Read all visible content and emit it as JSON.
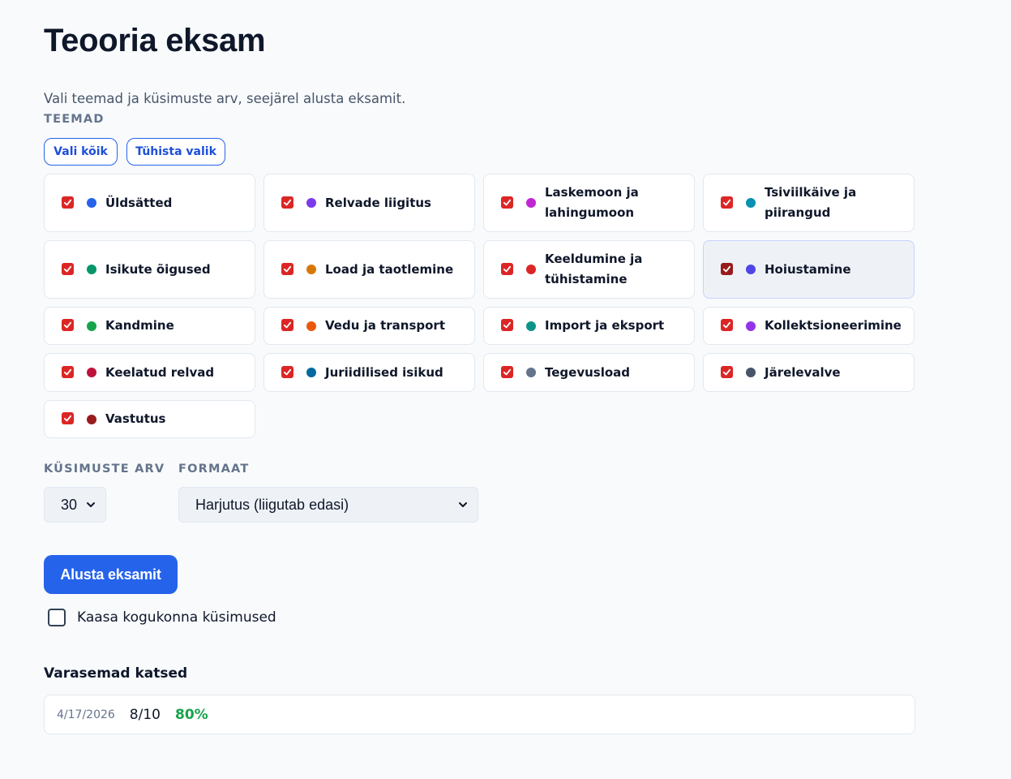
{
  "page": {
    "title": "Teooria eksam",
    "subtitle": "Vali teemad ja küsimuste arv, seejärel alusta eksamit."
  },
  "topics_section": {
    "label": "TEEMAD",
    "select_all": "Vali kõik",
    "clear_selection": "Tühista valik",
    "items": [
      {
        "label": "Üldsätted",
        "color": "#2563eb",
        "checked": true
      },
      {
        "label": "Relvade liigitus",
        "color": "#7c3aed",
        "checked": true
      },
      {
        "label": "Laskemoon ja lahingumoon",
        "color": "#c026d3",
        "checked": true
      },
      {
        "label": "Tsiviilkäive ja piirangud",
        "color": "#0891b2",
        "checked": true
      },
      {
        "label": "Isikute õigused",
        "color": "#059669",
        "checked": true
      },
      {
        "label": "Load ja taotlemine",
        "color": "#d97706",
        "checked": true
      },
      {
        "label": "Keeldumine ja tühistamine",
        "color": "#dc2626",
        "checked": true
      },
      {
        "label": "Hoiustamine",
        "color": "#4f46e5",
        "checked": true
      },
      {
        "label": "Kandmine",
        "color": "#16a34a",
        "checked": true
      },
      {
        "label": "Vedu ja transport",
        "color": "#ea580c",
        "checked": true
      },
      {
        "label": "Import ja eksport",
        "color": "#0d9488",
        "checked": true
      },
      {
        "label": "Kollektsioneerimine",
        "color": "#9333ea",
        "checked": true
      },
      {
        "label": "Keelatud relvad",
        "color": "#be123c",
        "checked": true
      },
      {
        "label": "Juriidilised isikud",
        "color": "#0369a1",
        "checked": true
      },
      {
        "label": "Tegevusload",
        "color": "#64748b",
        "checked": true
      },
      {
        "label": "Järelevalve",
        "color": "#475569",
        "checked": true
      },
      {
        "label": "Vastutus",
        "color": "#991b1b",
        "checked": true
      }
    ]
  },
  "options": {
    "count_label": "KÜSIMUSTE ARV",
    "count_value": "30",
    "format_label": "FORMAAT",
    "format_value": "Harjutus (liigutab edasi)"
  },
  "start_button": "Alusta eksamit",
  "community_checkbox": {
    "label": "Kaasa kogukonna küsimused",
    "checked": false
  },
  "history": {
    "title": "Varasemad katsed",
    "attempts": [
      {
        "date": "4/17/2026",
        "score": "8/10",
        "percent": "80%"
      }
    ]
  }
}
